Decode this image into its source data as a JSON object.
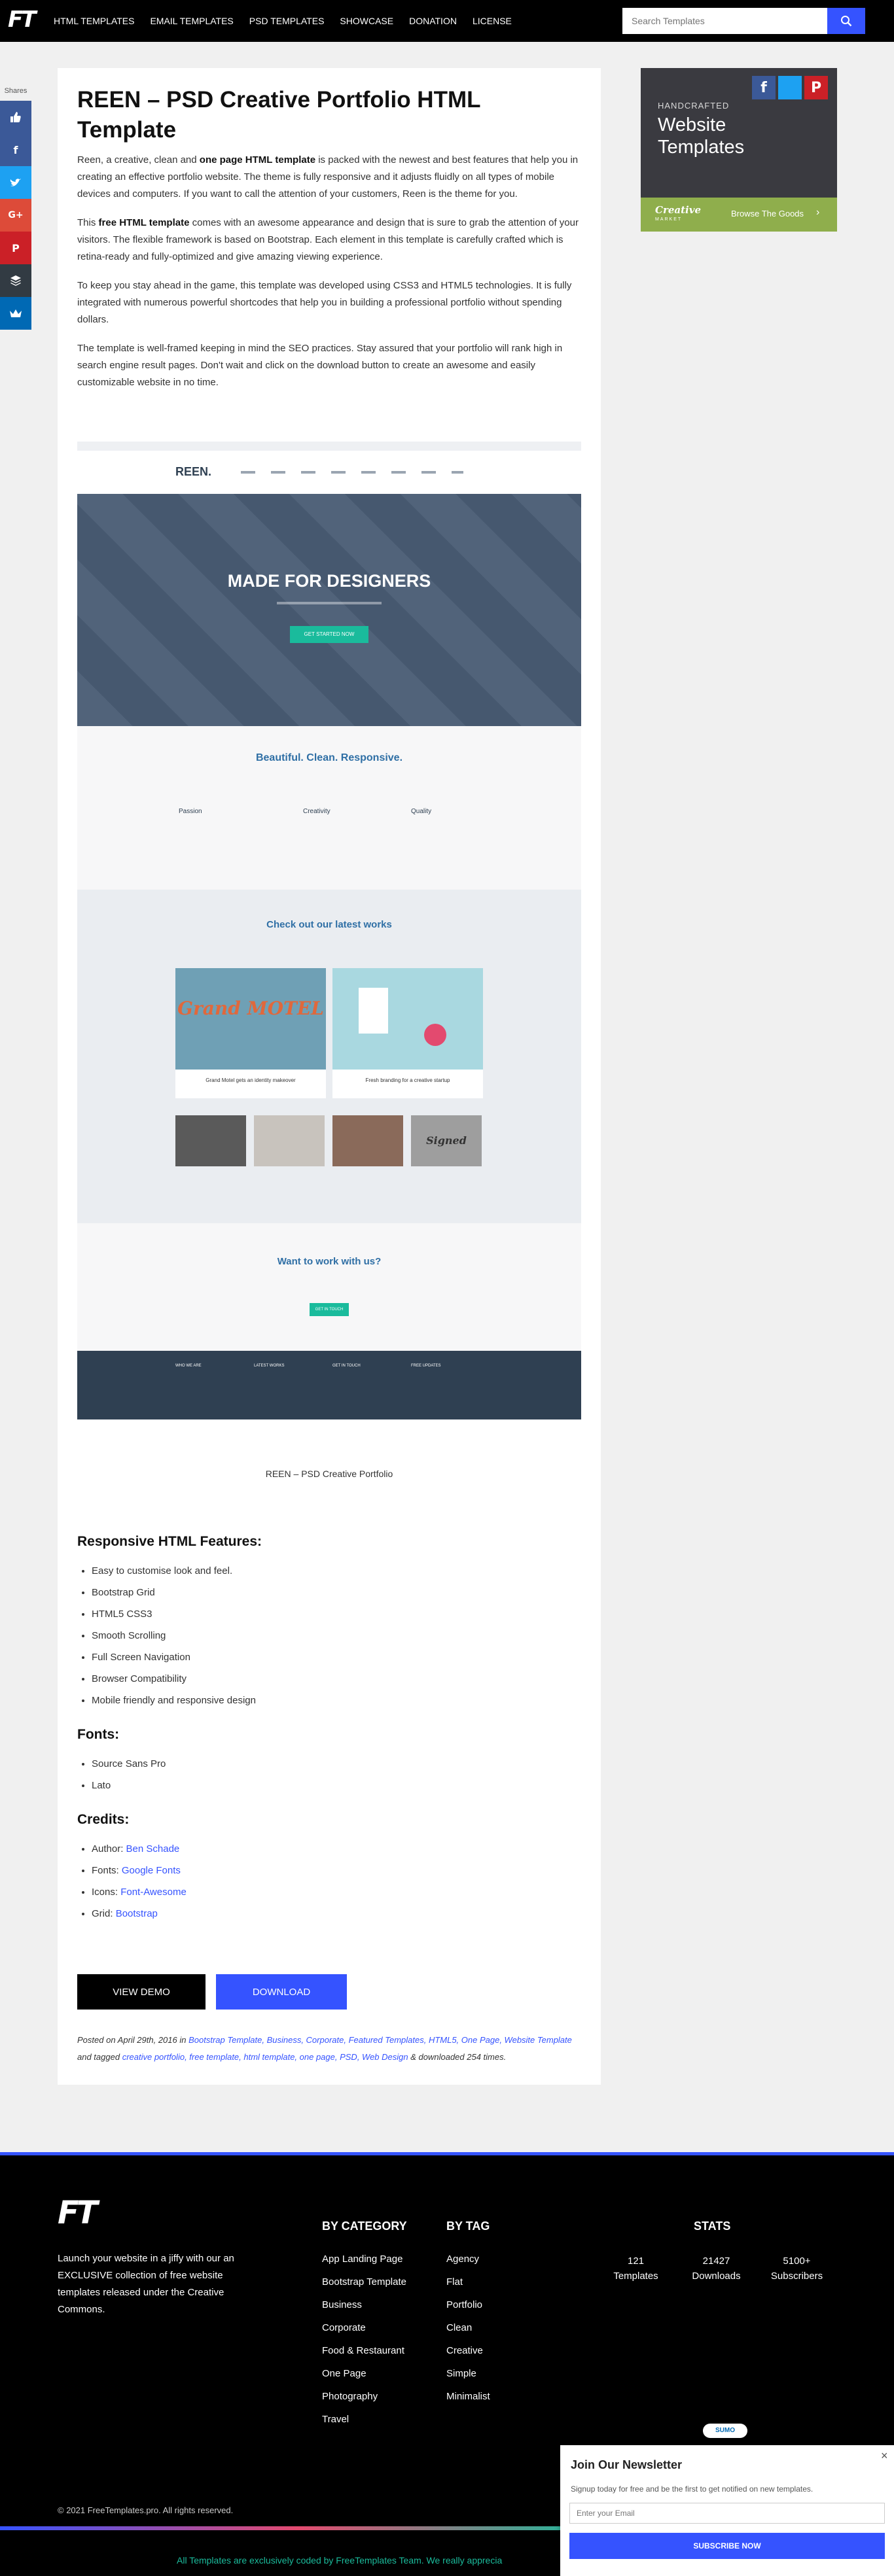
{
  "nav": {
    "logo": "FT",
    "items": [
      "HTML TEMPLATES",
      "EMAIL TEMPLATES",
      "PSD TEMPLATES",
      "SHOWCASE",
      "DONATION",
      "LICENSE"
    ],
    "search_placeholder": "Search Templates"
  },
  "share": {
    "label": "Shares",
    "buttons": [
      {
        "name": "like",
        "color": "#3b5998"
      },
      {
        "name": "facebook",
        "color": "#3b5998"
      },
      {
        "name": "twitter",
        "color": "#1da1f2"
      },
      {
        "name": "google-plus",
        "color": "#dd4b39"
      },
      {
        "name": "pinterest",
        "color": "#cb2027"
      },
      {
        "name": "buffer",
        "color": "#323b43"
      },
      {
        "name": "sumo",
        "color": "#0069b4"
      }
    ]
  },
  "article": {
    "title": "REEN – PSD Creative Portfolio HTML Template",
    "p1_a": "Reen, a creative, clean and ",
    "p1_b": "one page HTML template",
    "p1_c": " is packed with the newest and best features that help you in creating an effective portfolio website. The theme is fully responsive and it adjusts fluidly on all types of mobile devices and computers. If you want to call the attention of your customers, Reen is the theme for you.",
    "p2_a": "This ",
    "p2_b": "free HTML template",
    "p2_c": " comes with an awesome appearance and design that is sure to grab the attention of your visitors. The flexible framework is based on Bootstrap. Each element in this template is carefully crafted which is retina-ready and fully-optimized and give amazing viewing experience.",
    "p3": "To keep you stay ahead in the game, this template was developed using CSS3 and HTML5 technologies. It is fully integrated with numerous powerful shortcodes that help you in building a professional portfolio without spending dollars.",
    "p4": "The template is well-framed keeping in mind the SEO practices. Stay assured that your portfolio will rank high in search engine result pages. Don't wait and click on the download button to create an awesome and easily customizable website in no time.",
    "caption": "REEN – PSD Creative Portfolio",
    "features_title": "Responsive HTML Features:",
    "features": [
      "Easy to customise look and feel.",
      "Bootstrap Grid",
      "HTML5 CSS3",
      "Smooth Scrolling",
      "Full Screen Navigation",
      "Browser Compatibility",
      "Mobile friendly and responsive design"
    ],
    "fonts_title": "Fonts:",
    "fonts": [
      "Source Sans Pro",
      "Lato"
    ],
    "credits_title": "Credits:",
    "credits": [
      {
        "label": "Author: ",
        "link": "Ben Schade"
      },
      {
        "label": "Fonts: ",
        "link": "Google Fonts"
      },
      {
        "label": "Icons: ",
        "link": "Font-Awesome"
      },
      {
        "label": "Grid: ",
        "link": "Bootstrap"
      }
    ],
    "view_demo": "VIEW DEMO",
    "download": "DOWNLOAD",
    "posted_prefix": "Posted on April 29th, 2016 in ",
    "categories": "Bootstrap Template, Business, Corporate, Featured Templates, HTML5, One Page, Website Template",
    "tagged": " and tagged ",
    "tags": "creative portfolio, free template, html template, one page, PSD, Web Design",
    "downloaded": " & downloaded 254 times."
  },
  "preview": {
    "logo": "REEN.",
    "hero_title": "MADE FOR DESIGNERS",
    "hero_btn": "GET STARTED NOW",
    "section_title": "Beautiful. Clean. Responsive.",
    "features": [
      "Passion",
      "Creativity",
      "Quality"
    ],
    "works_title": "Check out our latest works",
    "work1_art": "Grand MOTEL",
    "work1": "Grand Motel gets an identity makeover",
    "work2": "Fresh branding for a creative startup",
    "work_thumb_text": "Signed",
    "cta_title": "Want to work with us?",
    "cta_btn": "GET IN TOUCH",
    "footer_cols": [
      "WHO WE ARE",
      "LATEST WORKS",
      "GET IN TOUCH",
      "FREE UPDATES"
    ],
    "colors": {
      "accent": "#1abb9c",
      "dark": "#2f4052",
      "hero": "#4a5d75"
    }
  },
  "ad": {
    "handcrafted": "HANDCRAFTED",
    "title": "Website Templates",
    "brand": "Creative",
    "brand_sub": "MARKET",
    "browse": "Browse The Goods"
  },
  "footer": {
    "logo": "FT",
    "tagline": "Launch your website in a jiffy with our an EXCLUSIVE collection of free website templates released under the Creative Commons.",
    "by_category": "BY CATEGORY",
    "categories": [
      "App Landing Page",
      "Bootstrap Template",
      "Business",
      "Corporate",
      "Food & Restaurant",
      "One Page",
      "Photography",
      "Travel"
    ],
    "by_tag": "BY TAG",
    "tags": [
      "Agency",
      "Flat",
      "Portfolio",
      "Clean",
      "Creative",
      "Simple",
      "Minimalist"
    ],
    "stats_title": "STATS",
    "stats": [
      {
        "value": "121",
        "label": "Templates"
      },
      {
        "value": "21427",
        "label": "Downloads"
      },
      {
        "value": "5100+",
        "label": "Subscribers"
      }
    ],
    "copyright": "© 2021 FreeTemplates.pro. All rights reserved.",
    "ticker": "All Templates are exclusively coded by FreeTemplates Team. We really apprecia"
  },
  "newsletter": {
    "sumo": "SUMO",
    "title": "Join Our Newsletter",
    "text": "Signup today for free and be the first to get notified on new templates.",
    "placeholder": "Enter your Email",
    "button": "SUBSCRIBE NOW",
    "close": "×"
  }
}
